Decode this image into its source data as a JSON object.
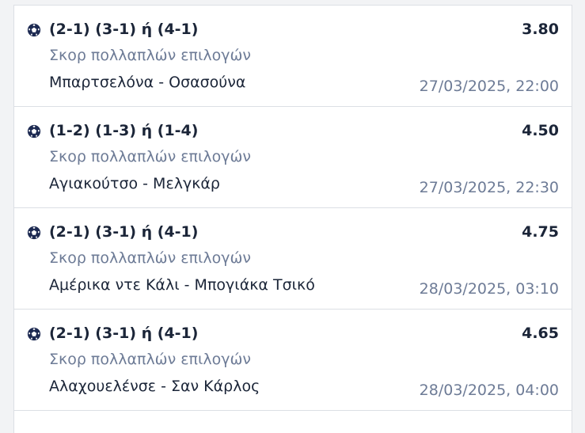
{
  "colors": {
    "text_primary": "#1b2538",
    "text_secondary": "#6d7b96",
    "icon": "#1d2a52",
    "divider": "#dcdfe4",
    "background": "#f2f3f5"
  },
  "bets": [
    {
      "icon": "soccer-ball-icon",
      "selection": "(2-1) (3-1) ή (4-1)",
      "odds": "3.80",
      "market": "Σκορ πολλαπλών επιλογών",
      "match": "Μπαρτσελόνα - Οσασούνα",
      "datetime": "27/03/2025, 22:00"
    },
    {
      "icon": "soccer-ball-icon",
      "selection": "(1-2) (1-3) ή (1-4)",
      "odds": "4.50",
      "market": "Σκορ πολλαπλών επιλογών",
      "match": "Αγιακούτσο - Μελγκάρ",
      "datetime": "27/03/2025, 22:30"
    },
    {
      "icon": "soccer-ball-icon",
      "selection": "(2-1) (3-1) ή (4-1)",
      "odds": "4.75",
      "market": "Σκορ πολλαπλών επιλογών",
      "match": "Αμέρικα ντε Κάλι - Μπογιάκα Τσικό",
      "datetime": "28/03/2025, 03:10"
    },
    {
      "icon": "soccer-ball-icon",
      "selection": "(2-1) (3-1) ή (4-1)",
      "odds": "4.65",
      "market": "Σκορ πολλαπλών επιλογών",
      "match": "Αλαχουελένσε - Σαν Κάρλος",
      "datetime": "28/03/2025, 04:00"
    }
  ]
}
